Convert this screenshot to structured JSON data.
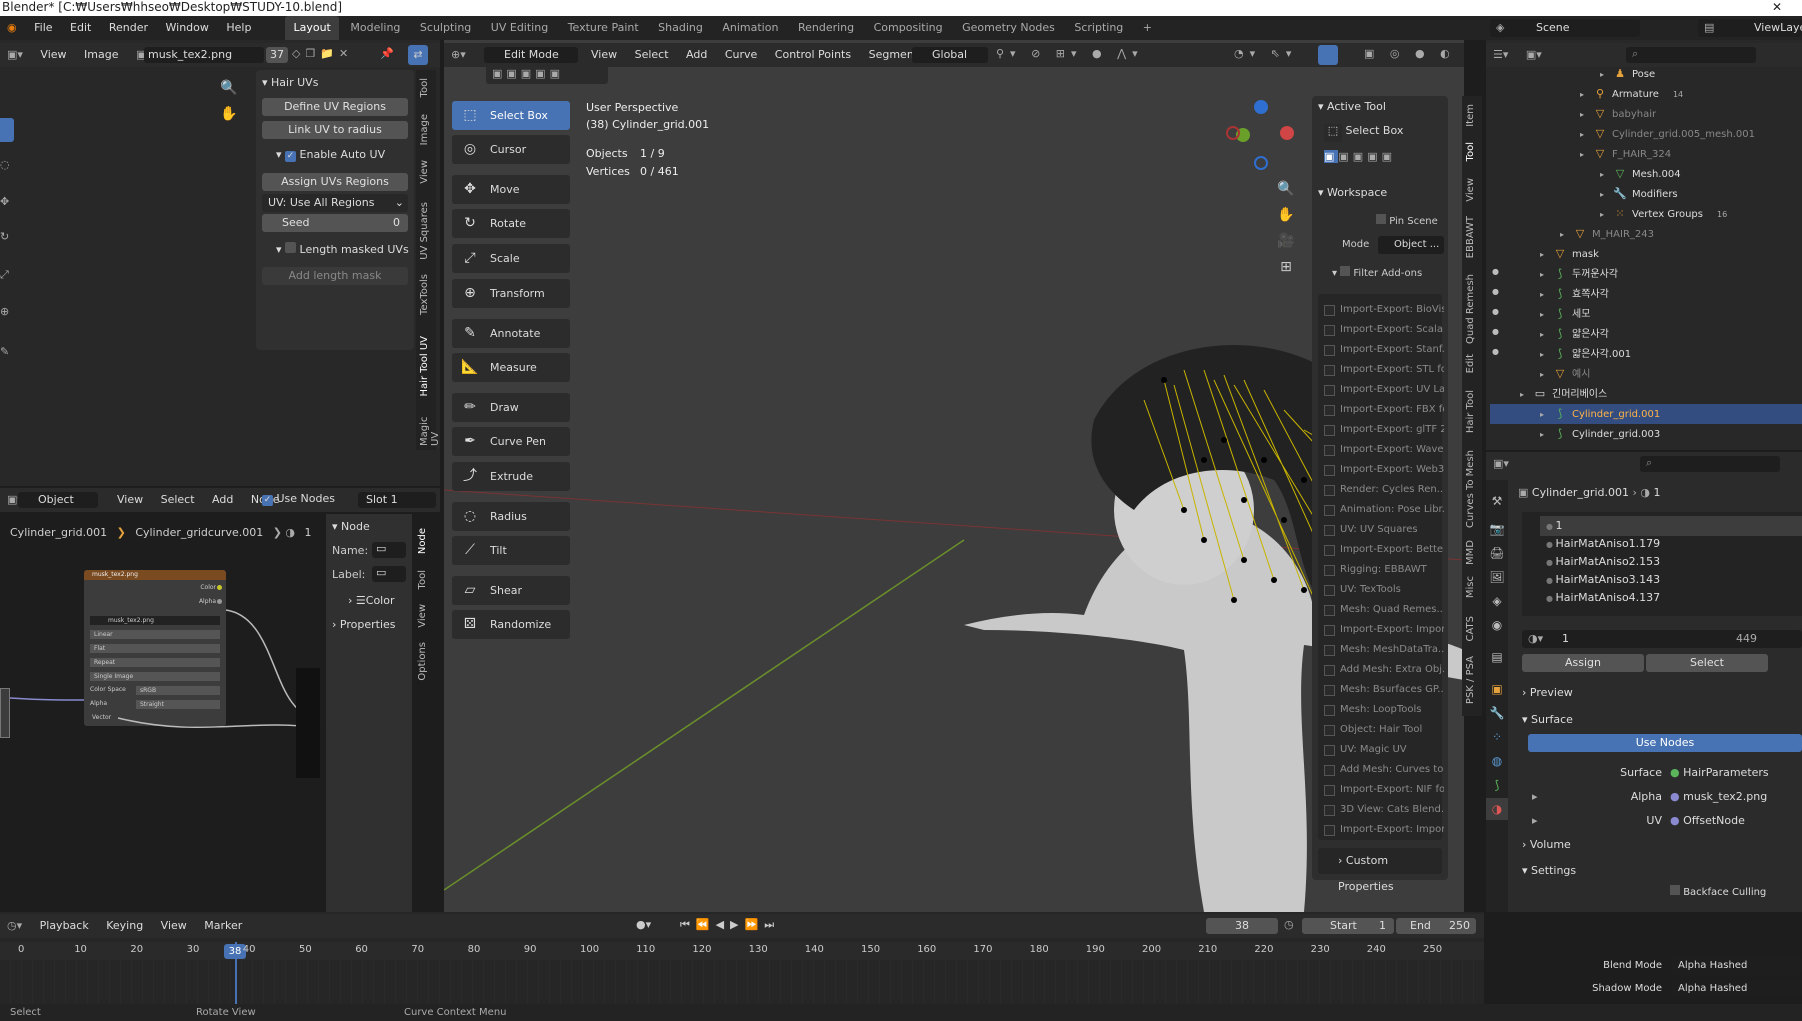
{
  "title_bar": "Blender* [C:₩Users₩hhseo₩Desktop₩STUDY-10.blend]",
  "menus": [
    "File",
    "Edit",
    "Render",
    "Window",
    "Help"
  ],
  "workspaces": [
    "Layout",
    "Modeling",
    "Sculpting",
    "UV Editing",
    "Texture Paint",
    "Shading",
    "Animation",
    "Rendering",
    "Compositing",
    "Geometry Nodes",
    "Scripting",
    "+"
  ],
  "active_workspace": "Layout",
  "scene": {
    "label": "Scene",
    "view_layer": "ViewLayer"
  },
  "image_editor": {
    "view": "View",
    "image": "Image",
    "image_name": "musk_tex2.png",
    "users": "37",
    "tabs": [
      "Tool",
      "Image",
      "View",
      "UV Squares",
      "TexTools",
      "Hair Tool UV",
      "Magic UV"
    ],
    "panel_title": "Hair UVs",
    "define": "Define UV Regions",
    "link": "Link UV to radius",
    "enable_auto": "Enable Auto UV",
    "assign": "Assign UVs Regions",
    "uv_select": "UV:  Use All Regions",
    "seed_label": "Seed",
    "seed_value": "0",
    "length_masked": "Length masked UVs",
    "add_mask": "Add length mask"
  },
  "node_editor": {
    "mode": "Object",
    "view": "View",
    "select": "Select",
    "add": "Add",
    "node": "Node",
    "use_nodes": "Use Nodes",
    "slot": "Slot 1",
    "breadcrumb": [
      "Cylinder_grid.001",
      "Cylinder_gridcurve.001",
      "1"
    ],
    "side_title": "Node",
    "name_label": "Name:",
    "label_label": "Label:",
    "color": "Color",
    "properties": "Properties",
    "tabs": [
      "Node",
      "Tool",
      "View",
      "Options"
    ],
    "img_node": {
      "title": "musk_tex2.png",
      "out_color": "Color",
      "out_alpha": "Alpha",
      "img": "musk_tex2.png",
      "users": "37",
      "interp": "Linear",
      "proj": "Flat",
      "ext": "Repeat",
      "source": "Single Image",
      "cs_label": "Color Space",
      "cs_value": "sRGB",
      "alpha_label": "Alpha",
      "alpha_value": "Straight",
      "vector": "Vector"
    }
  },
  "viewport": {
    "mode": "Edit Mode",
    "menus": [
      "View",
      "Select",
      "Add",
      "Curve",
      "Control Points",
      "Segments"
    ],
    "orientation": "Global",
    "persp": "User Perspective",
    "object": "(38) Cylinder_grid.001",
    "objects_label": "Objects",
    "objects_value": "1 / 9",
    "vertices_label": "Vertices",
    "vertices_value": "0 / 461",
    "tools": [
      "Select Box",
      "Cursor",
      "Move",
      "Rotate",
      "Scale",
      "Transform",
      "Annotate",
      "Measure",
      "Draw",
      "Curve Pen",
      "Extrude",
      "Radius",
      "Tilt",
      "Shear",
      "Randomize"
    ],
    "ntabs": [
      "Item",
      "Tool",
      "View",
      "EBBAWT",
      "Quad Remesh",
      "Edit",
      "Hair Tool",
      "Curves To Mesh",
      "MMD",
      "Misc",
      "CATS",
      "PSK / PSA"
    ],
    "active_tool_title": "Active Tool",
    "active_tool": "Select Box",
    "workspace_title": "Workspace",
    "pin_scene": "Pin Scene",
    "mode_label": "Mode",
    "mode_value": "Object ...",
    "filter_addons": "Filter Add-ons",
    "addons": [
      "Import-Export: BioVisi...",
      "Import-Export: Scala...",
      "Import-Export: Stanf...",
      "Import-Export: STL fo...",
      "Import-Export: UV La...",
      "Import-Export: FBX fo...",
      "Import-Export: glTF 2...",
      "Import-Export: Wave...",
      "Import-Export: Web3...",
      "Render: Cycles Ren...",
      "Animation: Pose Libr...",
      "UV: UV Squares",
      "Import-Export: Better...",
      "Rigging: EBBAWT",
      "UV: TexTools",
      "Mesh: Quad Remes...",
      "Import-Export: Impor...",
      "Mesh: MeshDataTra...",
      "Add Mesh: Extra Obj...",
      "Mesh: Bsurfaces GP...",
      "Mesh: LoopTools",
      "Object: Hair Tool",
      "UV: Magic UV",
      "Add Mesh: Curves to...",
      "Import-Export: NIF fo...",
      "3D View: Cats Blend...",
      "Import-Export: Impor..."
    ],
    "custom_props": "Custom Properties"
  },
  "timeline": {
    "playback": "Playback",
    "keying": "Keying",
    "view": "View",
    "marker": "Marker",
    "frame": "38",
    "start_label": "Start",
    "start": "1",
    "end_label": "End",
    "end": "250",
    "ticks": [
      "0",
      "10",
      "20",
      "30",
      "40",
      "50",
      "60",
      "70",
      "80",
      "90",
      "100",
      "110",
      "120",
      "130",
      "140",
      "150",
      "160",
      "170",
      "180",
      "190",
      "200",
      "210",
      "220",
      "230",
      "240",
      "250"
    ],
    "current": "38"
  },
  "outliner": {
    "items": [
      {
        "indent": 5,
        "name": "Pose",
        "icon": "pose-icon"
      },
      {
        "indent": 4,
        "name": "Armature",
        "icon": "armature-icon",
        "extra": "14"
      },
      {
        "indent": 4,
        "name": "babyhair",
        "icon": "mesh-icon",
        "dim": true
      },
      {
        "indent": 4,
        "name": "Cylinder_grid.005_mesh.001",
        "icon": "mesh-icon",
        "dim": true
      },
      {
        "indent": 4,
        "name": "F_HAIR_324",
        "icon": "mesh-icon",
        "dim": true
      },
      {
        "indent": 5,
        "name": "Mesh.004",
        "icon": "mesh-data-icon"
      },
      {
        "indent": 5,
        "name": "Modifiers",
        "icon": "wrench-icon"
      },
      {
        "indent": 5,
        "name": "Vertex Groups",
        "icon": "vgroup-icon",
        "extra": "16"
      },
      {
        "indent": 3,
        "name": "M_HAIR_243",
        "icon": "mesh-icon",
        "dim": true
      },
      {
        "indent": 2,
        "name": "mask",
        "icon": "mesh-icon"
      },
      {
        "indent": 2,
        "name": "두꺼운사각",
        "icon": "curve-icon"
      },
      {
        "indent": 2,
        "name": "효쪽사각",
        "icon": "curve-icon"
      },
      {
        "indent": 2,
        "name": "세모",
        "icon": "curve-icon"
      },
      {
        "indent": 2,
        "name": "얇은사각",
        "icon": "curve-icon"
      },
      {
        "indent": 2,
        "name": "얇은사각.001",
        "icon": "curve-icon"
      },
      {
        "indent": 2,
        "name": "예시",
        "icon": "mesh-icon",
        "dim": true
      },
      {
        "indent": 1,
        "name": "긴머리베이스",
        "icon": "collection-icon"
      },
      {
        "indent": 2,
        "name": "Cylinder_grid.001",
        "icon": "curve-icon",
        "selected": true
      },
      {
        "indent": 2,
        "name": "Cylinder_grid.003",
        "icon": "curve-icon"
      }
    ]
  },
  "properties": {
    "object": "Cylinder_grid.001",
    "slot": "1",
    "materials": [
      "1",
      "HairMatAniso1.179",
      "HairMatAniso2.153",
      "HairMatAniso3.143",
      "HairMatAniso4.137"
    ],
    "mat_name": "1",
    "mat_users": "449",
    "assign": "Assign",
    "select": "Select",
    "preview": "Preview",
    "surface_section": "Surface",
    "use_nodes": "Use Nodes",
    "surface_label": "Surface",
    "surface_value": "HairParameters",
    "alpha_label": "Alpha",
    "alpha_value": "musk_tex2.png",
    "uv_label": "UV",
    "uv_value": "OffsetNode",
    "volume": "Volume",
    "settings": "Settings",
    "backface": "Backface Culling",
    "blend_label": "Blend Mode",
    "blend_value": "Alpha Hashed",
    "shadow_label": "Shadow Mode",
    "shadow_value": "Alpha Hashed"
  },
  "status": {
    "left": "Select",
    "mid": "Rotate View",
    "right": "Curve Context Menu"
  },
  "colors": {
    "accent": "#4772b3",
    "hair": "#c8b400",
    "axis_x": "#a33",
    "axis_y": "#7a3"
  }
}
